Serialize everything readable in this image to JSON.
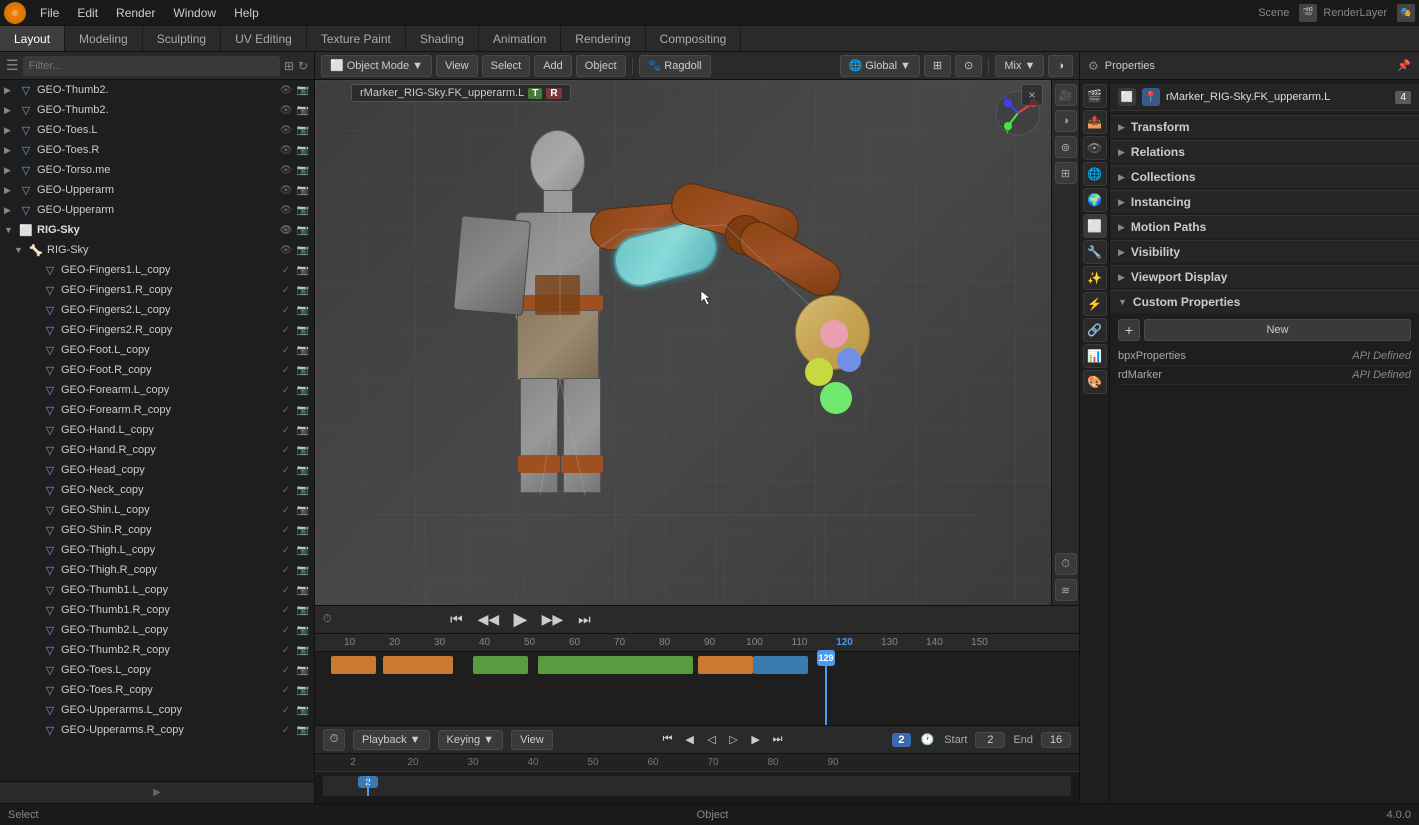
{
  "app": {
    "title": "Blender",
    "version": "4.0.0"
  },
  "menubar": {
    "items": [
      "File",
      "Edit",
      "Render",
      "Window",
      "Help"
    ]
  },
  "tabs": {
    "items": [
      "Layout",
      "Modeling",
      "Sculpting",
      "UV Editing",
      "Texture Paint",
      "Shading",
      "Animation",
      "Rendering",
      "Compositing"
    ]
  },
  "header": {
    "active_tab": "Layout",
    "workspace": "Layout"
  },
  "viewport": {
    "mode": "Object Mode",
    "overlays": "Mix",
    "transform_global": "Global",
    "ragdoll": "Ragdoll",
    "active_object": "rMarker_RIG-Sky.FK_upperarm.L",
    "badge_t": "T",
    "badge_r": "R",
    "scene_name": "Scene",
    "render_layer": "RenderLayer"
  },
  "outliner": {
    "search_placeholder": "Filter...",
    "items": [
      {
        "label": "GEO-Thumb2.",
        "indent": 0,
        "type": "mesh"
      },
      {
        "label": "GEO-Thumb2.",
        "indent": 0,
        "type": "mesh"
      },
      {
        "label": "GEO-Toes.L",
        "indent": 0,
        "type": "mesh"
      },
      {
        "label": "GEO-Toes.R",
        "indent": 0,
        "type": "mesh"
      },
      {
        "label": "GEO-Torso.me",
        "indent": 0,
        "type": "mesh"
      },
      {
        "label": "GEO-Upperarm",
        "indent": 0,
        "type": "mesh"
      },
      {
        "label": "GEO-Upperarm",
        "indent": 0,
        "type": "mesh"
      },
      {
        "label": "RIG-Sky",
        "indent": 0,
        "type": "armature",
        "group": true
      },
      {
        "label": "RIG-Sky",
        "indent": 1,
        "type": "armature"
      },
      {
        "label": "GEO-Fingers1.L_copy",
        "indent": 2,
        "type": "mesh"
      },
      {
        "label": "GEO-Fingers1.R_copy",
        "indent": 2,
        "type": "mesh"
      },
      {
        "label": "GEO-Fingers2.L_copy",
        "indent": 2,
        "type": "mesh"
      },
      {
        "label": "GEO-Fingers2.R_copy",
        "indent": 2,
        "type": "mesh"
      },
      {
        "label": "GEO-Foot.L_copy",
        "indent": 2,
        "type": "mesh"
      },
      {
        "label": "GEO-Foot.R_copy",
        "indent": 2,
        "type": "mesh"
      },
      {
        "label": "GEO-Forearm.L_copy",
        "indent": 2,
        "type": "mesh"
      },
      {
        "label": "GEO-Forearm.R_copy",
        "indent": 2,
        "type": "mesh"
      },
      {
        "label": "GEO-Hand.L_copy",
        "indent": 2,
        "type": "mesh"
      },
      {
        "label": "GEO-Hand.R_copy",
        "indent": 2,
        "type": "mesh"
      },
      {
        "label": "GEO-Head_copy",
        "indent": 2,
        "type": "mesh"
      },
      {
        "label": "GEO-Neck_copy",
        "indent": 2,
        "type": "mesh"
      },
      {
        "label": "GEO-Shin.L_copy",
        "indent": 2,
        "type": "mesh"
      },
      {
        "label": "GEO-Shin.R_copy",
        "indent": 2,
        "type": "mesh"
      },
      {
        "label": "GEO-Thigh.L_copy",
        "indent": 2,
        "type": "mesh"
      },
      {
        "label": "GEO-Thigh.R_copy",
        "indent": 2,
        "type": "mesh"
      },
      {
        "label": "GEO-Thumb1.L_copy",
        "indent": 2,
        "type": "mesh"
      },
      {
        "label": "GEO-Thumb1.R_copy",
        "indent": 2,
        "type": "mesh"
      },
      {
        "label": "GEO-Thumb2.L_copy",
        "indent": 2,
        "type": "mesh"
      },
      {
        "label": "GEO-Thumb2.R_copy",
        "indent": 2,
        "type": "mesh"
      },
      {
        "label": "GEO-Toes.L_copy",
        "indent": 2,
        "type": "mesh"
      },
      {
        "label": "GEO-Toes.R_copy",
        "indent": 2,
        "type": "mesh"
      },
      {
        "label": "GEO-Upperarms.L_copy",
        "indent": 2,
        "type": "mesh"
      },
      {
        "label": "GEO-Upperarms.R_copy",
        "indent": 2,
        "type": "mesh"
      }
    ]
  },
  "properties": {
    "active_object": "rMarker_RIG-Sky.FK_upperarm.L",
    "object_number": "4",
    "sections": [
      {
        "label": "Transform",
        "collapsed": false
      },
      {
        "label": "Relations",
        "collapsed": false
      },
      {
        "label": "Collections",
        "collapsed": false
      },
      {
        "label": "Instancing",
        "collapsed": false
      },
      {
        "label": "Motion Paths",
        "collapsed": false
      },
      {
        "label": "Visibility",
        "collapsed": false
      },
      {
        "label": "Viewport Display",
        "collapsed": false
      },
      {
        "label": "Custom Properties",
        "collapsed": false,
        "expanded": true
      }
    ],
    "custom_props": {
      "add_label": "+",
      "new_label": "New",
      "items": [
        {
          "name": "bpxProperties",
          "value": "API Defined"
        },
        {
          "name": "rdMarker",
          "value": "API Defined"
        }
      ]
    }
  },
  "timeline": {
    "frame_current": "129",
    "frame_start": "2",
    "frame_end": "16",
    "start_label": "Start",
    "end_label": "End",
    "ruler_marks": [
      "10",
      "20",
      "30",
      "40",
      "50",
      "60",
      "70",
      "80",
      "90",
      "100",
      "110",
      "120",
      "130",
      "140",
      "150"
    ],
    "controls": {
      "jump_start": "⏮",
      "step_back": "◀",
      "play": "▶",
      "step_fwd": "▶|",
      "jump_end": "⏭"
    }
  },
  "bottom_bar": {
    "playback_label": "Playback",
    "keying_label": "Keying",
    "view_label": "View",
    "frame_label": "2",
    "start_label": "Start",
    "start_val": "2",
    "end_label": "End",
    "end_val": "16"
  },
  "status_bar": {
    "left": "Select",
    "right": "Object",
    "version": "4.0.0"
  },
  "second_ruler": {
    "marks": [
      "2",
      "20",
      "30",
      "40",
      "50",
      "60",
      "70",
      "80",
      "90"
    ]
  }
}
